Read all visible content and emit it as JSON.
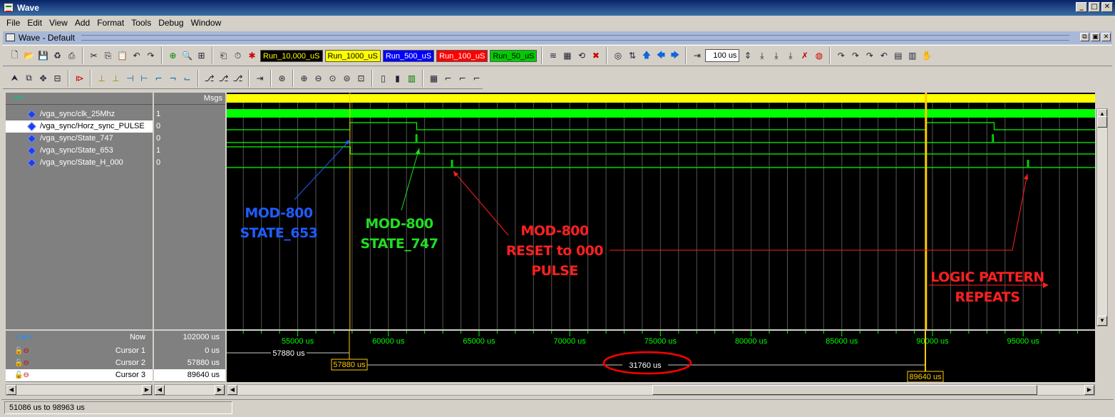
{
  "window": {
    "title": "Wave"
  },
  "menu": [
    "File",
    "Edit",
    "View",
    "Add",
    "Format",
    "Tools",
    "Debug",
    "Window"
  ],
  "subwindow": {
    "title": "Wave - Default"
  },
  "toolbar": {
    "run_buttons": [
      {
        "label": "Run_10,000_uS",
        "bg": "#000000",
        "fg": "#ffff00"
      },
      {
        "label": "Run_1000_uS",
        "bg": "#ffff00",
        "fg": "#000000"
      },
      {
        "label": "Run_500_uS",
        "bg": "#0000ff",
        "fg": "#ffffff"
      },
      {
        "label": "Run_100_uS",
        "bg": "#ff0000",
        "fg": "#ffffff"
      },
      {
        "label": "Run_50_uS",
        "bg": "#00cc00",
        "fg": "#000000"
      }
    ],
    "run_length": "100 us"
  },
  "wave": {
    "msgs_label": "Msgs",
    "signals": [
      {
        "name": "/vga_sync/clk_25Mhz",
        "value": "1"
      },
      {
        "name": "/vga_sync/Horz_sync_PULSE",
        "value": "0"
      },
      {
        "name": "/vga_sync/State_747",
        "value": "0"
      },
      {
        "name": "/vga_sync/State_653",
        "value": "1"
      },
      {
        "name": "/vga_sync/State_H_000",
        "value": "0"
      }
    ],
    "signal_color": "#00ff00",
    "cursor_color": "#ffcc00"
  },
  "cursors": {
    "rows": [
      {
        "label": "Now",
        "value": "102000 us"
      },
      {
        "label": "Cursor 1",
        "value": "0 us"
      },
      {
        "label": "Cursor 2",
        "value": "57880 us"
      },
      {
        "label": "Cursor 3",
        "value": "89640 us"
      }
    ],
    "cursor1_delta": "57880 us",
    "cursor2_tag": "57880 us",
    "cursor3_tag": "89640 us",
    "delta_label": "31760 us"
  },
  "timeline": {
    "range_start_us": 51086,
    "range_end_us": 98963,
    "ticks": [
      "55000 us",
      "60000 us",
      "65000 us",
      "70000 us",
      "75000 us",
      "80000 us",
      "85000 us",
      "90000 us",
      "95000 us"
    ],
    "tick_values": [
      55000,
      60000,
      65000,
      70000,
      75000,
      80000,
      85000,
      90000,
      95000
    ]
  },
  "annotations": {
    "a653": {
      "line1": "MOD-800",
      "line2": "STATE_653",
      "color": "#1e5cff"
    },
    "a747": {
      "line1": "MOD-800",
      "line2": "STATE_747",
      "color": "#22dd22"
    },
    "a000": {
      "line1": "MOD-800",
      "line2": "RESET to 000",
      "line3": "PULSE",
      "color": "#ff2020"
    },
    "repeat": {
      "line1": "LOGIC PATTERN",
      "line2": "REPEATS",
      "color": "#ff2020"
    }
  },
  "status": {
    "range_text": "51086 us to 98963 us"
  }
}
